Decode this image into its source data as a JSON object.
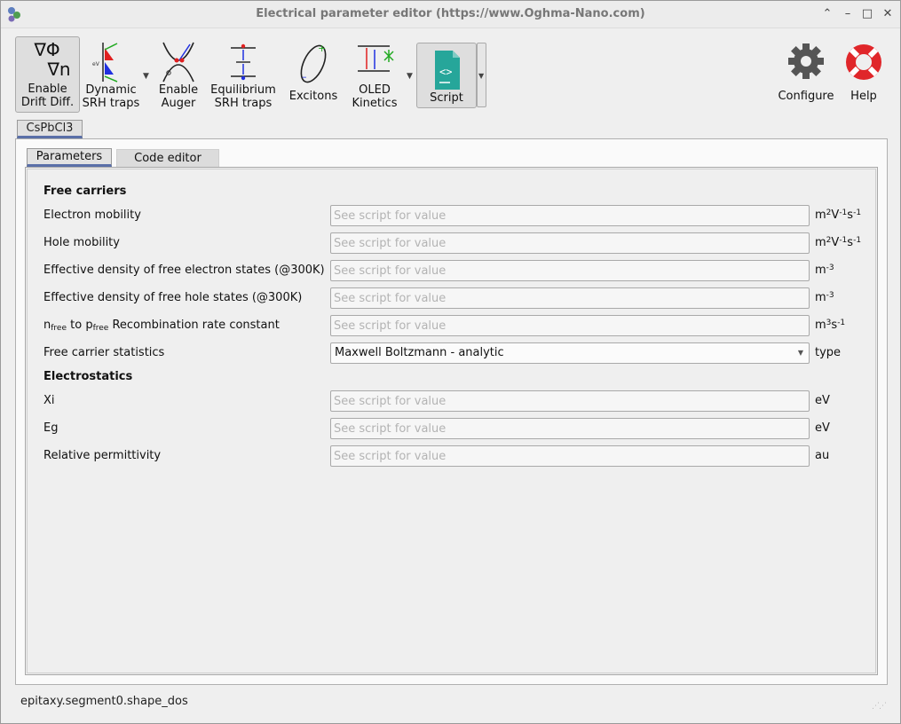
{
  "window": {
    "title": "Electrical parameter editor (https://www.Oghma-Nano.com)",
    "controls": {
      "collapse": "⌃",
      "minimize": "–",
      "maximize": "□",
      "close": "✕"
    }
  },
  "toolbar": {
    "items": [
      {
        "line1": "Enable",
        "line2": "Drift Diff.",
        "icon": "gradient-phi-n-icon",
        "glyph1": "∇Φ",
        "glyph2": "∇n",
        "active": true
      },
      {
        "line1": "Dynamic",
        "line2": "SRH traps",
        "icon": "srh-traps-icon",
        "has_dropdown": true
      },
      {
        "line1": "Enable",
        "line2": "Auger",
        "icon": "auger-icon"
      },
      {
        "line1": "Equilibrium",
        "line2": "SRH traps",
        "icon": "equilibrium-srh-icon"
      },
      {
        "line1": "Excitons",
        "line2": "",
        "icon": "excitons-icon"
      },
      {
        "line1": "OLED",
        "line2": "Kinetics",
        "icon": "oled-kinetics-icon",
        "has_dropdown": true
      },
      {
        "line1": "Script",
        "line2": "",
        "icon": "script-icon",
        "active": true,
        "has_dropdown": true
      }
    ],
    "configure_label": "Configure",
    "help_label": "Help"
  },
  "material_tab": "CsPbCl3",
  "tabs": {
    "parameters": "Parameters",
    "code_editor": "Code editor"
  },
  "sections": {
    "free_carriers": "Free carriers",
    "electrostatics": "Electrostatics"
  },
  "placeholder": "See script for value",
  "rows": {
    "electron_mobility": {
      "label": "Electron mobility",
      "unit": "m2V-1s-1"
    },
    "hole_mobility": {
      "label": "Hole mobility",
      "unit": "m2V-1s-1"
    },
    "nc": {
      "label": "Effective density of free electron states (@300K)",
      "unit": "m-3"
    },
    "nv": {
      "label": "Effective density of free hole states (@300K)",
      "unit": "m-3"
    },
    "recomb": {
      "label_pre": "n",
      "label_sub1": "free",
      "label_mid": " to p",
      "label_sub2": "free",
      "label_post": " Recombination rate constant",
      "unit": "m3s-1"
    },
    "statistics": {
      "label": "Free carrier statistics",
      "value": "Maxwell Boltzmann - analytic",
      "unit": "type"
    },
    "xi": {
      "label": "Xi",
      "unit": "eV"
    },
    "eg": {
      "label": "Eg",
      "unit": "eV"
    },
    "epsilon": {
      "label": "Relative permittivity",
      "unit": "au"
    }
  },
  "status": "epitaxy.segment0.shape_dos",
  "colors": {
    "accent": "#5a6fa8",
    "help_red": "#e0262a",
    "script_teal": "#26a69a"
  }
}
